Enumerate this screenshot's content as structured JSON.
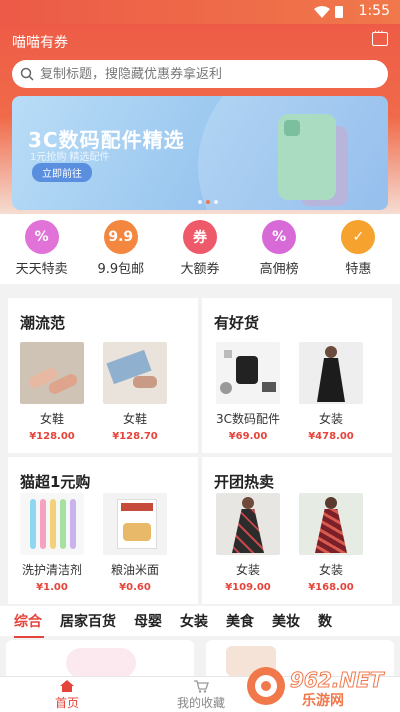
{
  "statusbar": {
    "time": "1:55"
  },
  "app": {
    "title": "喵喵有券"
  },
  "search": {
    "placeholder": "复制标题，搜隐藏优惠券拿返利"
  },
  "banner": {
    "title": "3C数码配件精选",
    "subtitle": "1元抢购 精选配件",
    "button": "立即前往",
    "dots": 3,
    "active_dot": 1
  },
  "quick_nav": [
    {
      "label": "天天特卖",
      "icon": "percent-icon",
      "color": "#e072d8",
      "glyph": "%"
    },
    {
      "label": "9.9包邮",
      "icon": "nine-nine-icon",
      "color": "#f3873f",
      "glyph": "9.9"
    },
    {
      "label": "大额券",
      "icon": "coupon-icon",
      "color": "#ef5a6a",
      "glyph": "券"
    },
    {
      "label": "高佣榜",
      "icon": "percent-tag-icon",
      "color": "#d86ad8",
      "glyph": "%"
    },
    {
      "label": "特惠",
      "icon": "calendar-icon",
      "color": "#f5a22f",
      "glyph": "✓"
    }
  ],
  "panels": [
    {
      "title": "潮流范",
      "items": [
        {
          "name": "女鞋",
          "price": "¥128.00",
          "img": "shoes"
        },
        {
          "name": "女鞋",
          "price": "¥128.70",
          "img": "jeans"
        }
      ]
    },
    {
      "title": "有好货",
      "items": [
        {
          "name": "3C数码配件",
          "price": "¥69.00",
          "img": "gadgets"
        },
        {
          "name": "女装",
          "price": "¥478.00",
          "img": "dress-black"
        }
      ]
    },
    {
      "title": "猫超1元购",
      "items": [
        {
          "name": "洗护清洁剂",
          "price": "¥1.00",
          "img": "toothbrush"
        },
        {
          "name": "粮油米面",
          "price": "¥0.60",
          "img": "snack"
        }
      ]
    },
    {
      "title": "开团热卖",
      "items": [
        {
          "name": "女装",
          "price": "¥109.00",
          "img": "dress-floral"
        },
        {
          "name": "女装",
          "price": "¥168.00",
          "img": "dress-red"
        }
      ]
    }
  ],
  "categories": [
    {
      "label": "综合",
      "active": true
    },
    {
      "label": "居家百货"
    },
    {
      "label": "母婴"
    },
    {
      "label": "女装"
    },
    {
      "label": "美食"
    },
    {
      "label": "美妆"
    },
    {
      "label": "数"
    }
  ],
  "tabbar": [
    {
      "label": "首页",
      "icon": "home-icon",
      "active": true
    },
    {
      "label": "我的收藏",
      "icon": "cart-icon"
    }
  ],
  "watermark": {
    "line1": "962.NET",
    "line2": "乐游网"
  }
}
